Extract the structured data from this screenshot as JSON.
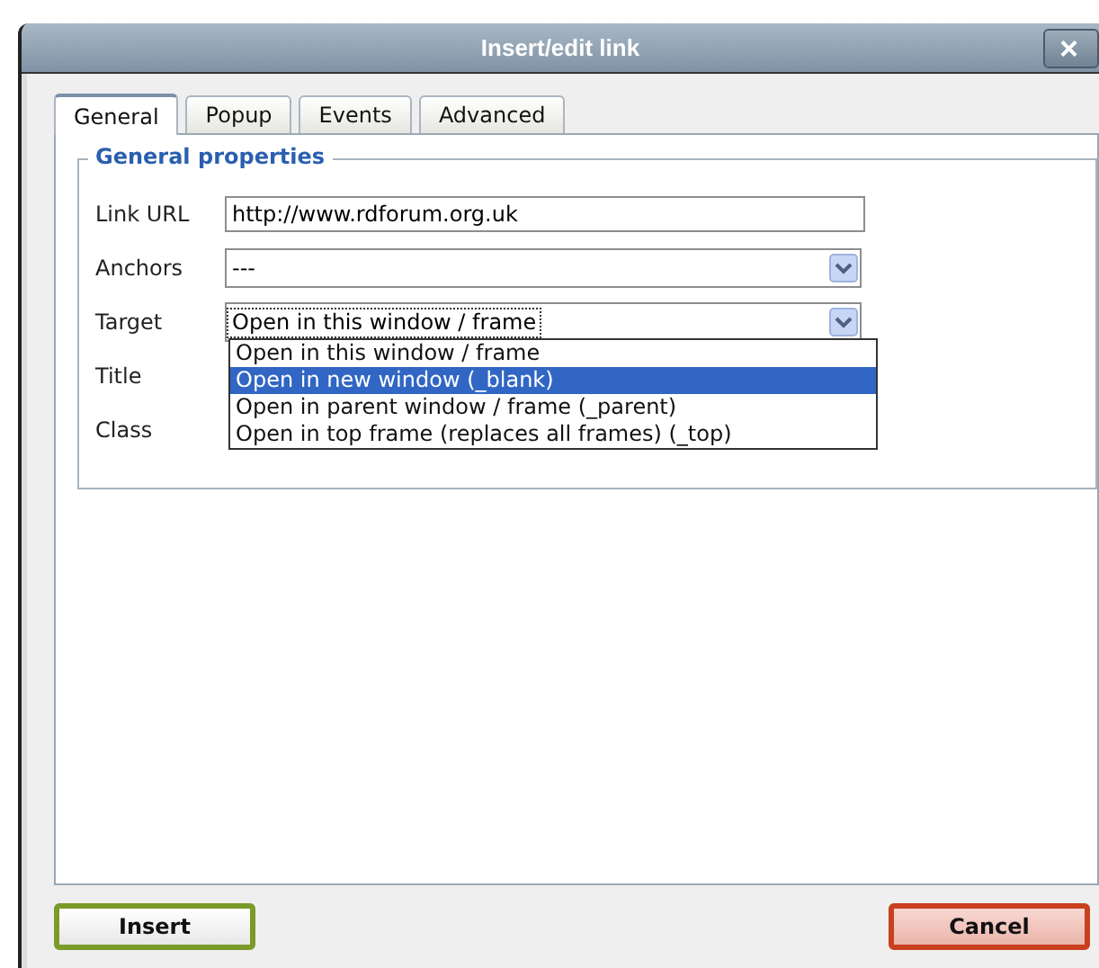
{
  "window": {
    "title": "Insert/edit link",
    "close": "×"
  },
  "tabs": [
    {
      "label": "General",
      "selected": true
    },
    {
      "label": "Popup",
      "selected": false
    },
    {
      "label": "Events",
      "selected": false
    },
    {
      "label": "Advanced",
      "selected": false
    }
  ],
  "fieldset": {
    "legend": "General properties",
    "fields": [
      {
        "label": "Link URL",
        "kind": "text",
        "value": "http://www.rdforum.org.uk"
      },
      {
        "label": "Anchors",
        "kind": "select",
        "value": "---",
        "focused": false
      },
      {
        "label": "Target",
        "kind": "select",
        "value": "Open in this window / frame",
        "focused": true,
        "expanded": true,
        "options": [
          {
            "label": "Open in this window / frame",
            "highlighted": false
          },
          {
            "label": "Open in new window (_blank)",
            "highlighted": true
          },
          {
            "label": "Open in parent window / frame (_parent)",
            "highlighted": false
          },
          {
            "label": "Open in top frame (replaces all frames) (_top)",
            "highlighted": false
          }
        ]
      },
      {
        "label": "Title",
        "kind": "hidden"
      },
      {
        "label": "Class",
        "kind": "hidden"
      }
    ]
  },
  "buttons": [
    {
      "label": "Insert",
      "kind": "confirm"
    },
    {
      "label": "Cancel",
      "kind": "cancel"
    }
  ]
}
